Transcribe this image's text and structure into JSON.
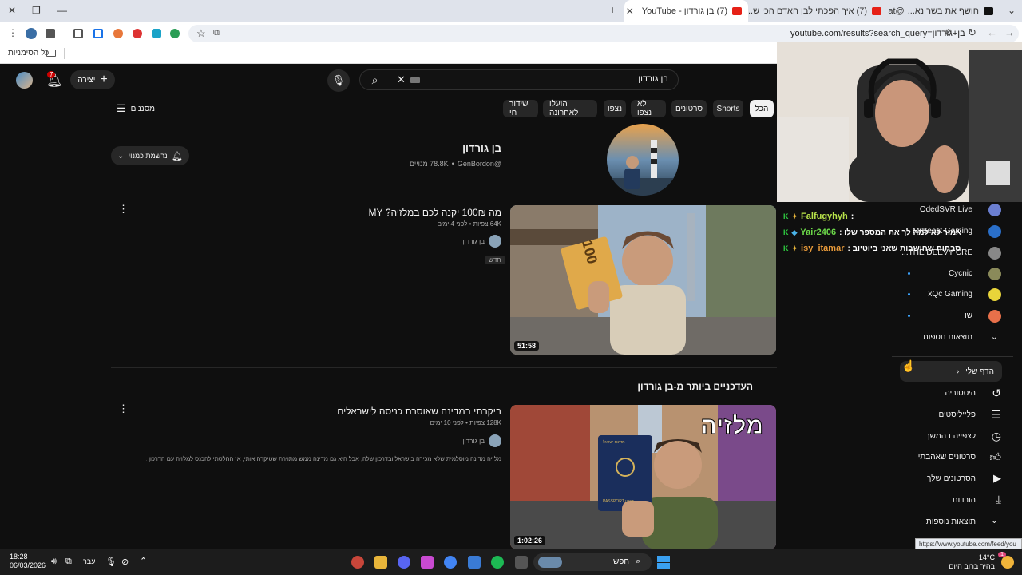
{
  "browser": {
    "tabs": [
      {
        "title": "חושף את בשר נא...",
        "prefix": "@meat_"
      },
      {
        "title": "(7) איך הפכתי לבן האדם הכי ש..."
      },
      {
        "title": "(7) בן גורדון - YouTube"
      }
    ],
    "url": "youtube.com/results?search_query=בן+גורדון",
    "bookmarks_label": "כל הסימניות"
  },
  "youtube": {
    "search_value": "בן גורדון",
    "create_label": "יצירה",
    "notif_count": "7",
    "filters_label": "מסננים",
    "chips": [
      "הכל",
      "Shorts",
      "סרטונים",
      "לא נצפו",
      "נצפו",
      "הועלו לאחרונה",
      "שידור חי"
    ],
    "channel": {
      "name": "בן גורדון",
      "handle": "@GenBordon",
      "subs": "78.8K מנויים",
      "subscribed_label": "נרשמת כמנוי"
    },
    "video1": {
      "title": "מה 100₪ יקנה לכם במלזיה? MY",
      "meta": "64K צפיות • לפני 4 ימים",
      "channel": "בן גורדון",
      "badge": "חדש",
      "duration": "51:58"
    },
    "section_title": "העדכניים ביותר מ-בן גורדון",
    "video2": {
      "title": "ביקרתי במדינה שאוסרת כניסה לישראלים",
      "meta": "128K צפיות • לפני 10 ימים",
      "channel": "בן גורדון",
      "desc": "מלזיה מדינה מוסלמית שלא מכירה בישראל ובדרכון שלה, אבל היא גם מדינה ממש מתוירת שטיקרה אותי, אז החלטתי להכנס למלזיה עם הדרכון ...",
      "duration": "1:02:26",
      "overlay": "מלזיה",
      "passport_top": "מדינת ישראל",
      "passport_bottom": "דרכון PASSPORT"
    },
    "banknote": "100"
  },
  "chat": [
    {
      "user": "Falfugyhyh",
      "msg": ""
    },
    {
      "user": "Yair2406",
      "msg": "אמור לא למה לך את המספר שלו :"
    },
    {
      "user": "isy_itamar",
      "msg": "סבתות שחושבות שאני ביוטיוב :"
    }
  ],
  "sidebar": {
    "subs": [
      {
        "name": "OdedSVR Live"
      },
      {
        "name": "MrBeast Gaming"
      },
      {
        "name": "THE DEEVY CRE..."
      },
      {
        "name": "Cycnic"
      },
      {
        "name": "xQc Gaming"
      },
      {
        "name": "שו"
      }
    ],
    "more1": "תוצאות נוספות",
    "my_page": "הדף שלי",
    "items": [
      "היסטוריה",
      "פלייליסטים",
      "לצפייה בהמשך",
      "סרטונים שאהבתי",
      "הסרטונים שלך",
      "הורדות"
    ],
    "more2": "תוצאות נוספות",
    "status_url": "https://www.youtube.com/feed/you"
  },
  "taskbar": {
    "time": "18:28",
    "date": "06/03/2026",
    "lang": "עבר",
    "search": "חפש",
    "weather_temp": "14°C",
    "weather_desc": "בהיר ברוב היום",
    "weather_badge": "1"
  }
}
